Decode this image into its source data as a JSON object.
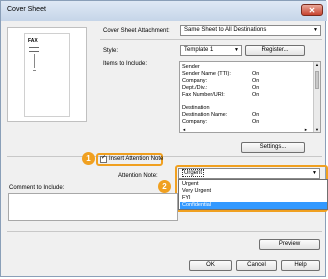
{
  "window": {
    "title": "Cover Sheet",
    "close_glyph": "✕"
  },
  "cover_sheet_attachment": {
    "label": "Cover Sheet Attachment:",
    "value": "Same Sheet to All Destinations"
  },
  "preview": {
    "fax_text": "FAX"
  },
  "style": {
    "label": "Style:",
    "value": "Template 1",
    "register_label": "Register..."
  },
  "items": {
    "label": "Items to Include:",
    "rows": [
      {
        "name": "Sender",
        "value": ""
      },
      {
        "name": "Sender Name (TTI):",
        "value": "On"
      },
      {
        "name": "Company:",
        "value": "On"
      },
      {
        "name": "Dept./Div.:",
        "value": "On"
      },
      {
        "name": "Fax Number/URI:",
        "value": "On"
      },
      {
        "name": "",
        "value": ""
      },
      {
        "name": "Destination",
        "value": ""
      },
      {
        "name": "Destination Name:",
        "value": "On"
      },
      {
        "name": "Company:",
        "value": "On"
      }
    ]
  },
  "settings_label": "Settings...",
  "insert_attention": {
    "label": "Insert Attention Note",
    "checked": true
  },
  "attention_note": {
    "label": "Attention Note:",
    "value": "Urgent",
    "options": [
      "Urgent",
      "Very Urgent",
      "FYI",
      "Confidential"
    ],
    "selected": "Confidential"
  },
  "comment_label": "Comment to Include:",
  "preview_button": "Preview",
  "ok_label": "OK",
  "cancel_label": "Cancel",
  "help_label": "Help",
  "badges": [
    "1",
    "2"
  ],
  "colors": {
    "accent": "#f0a020",
    "selection": "#3399ff"
  }
}
